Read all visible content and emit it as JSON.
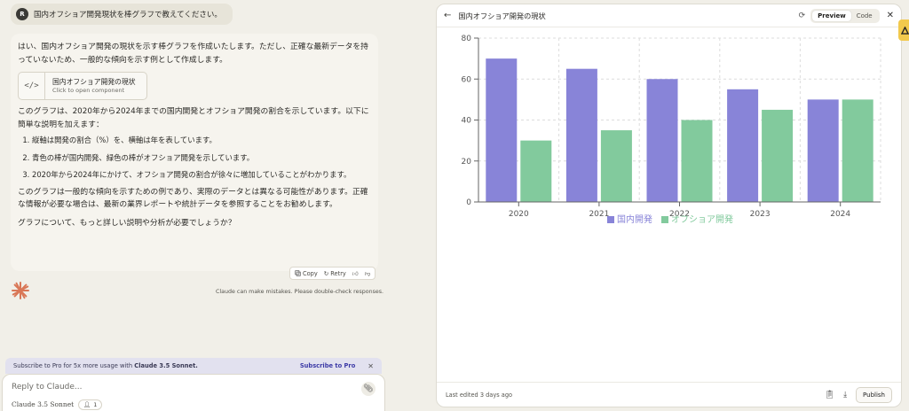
{
  "user_message": {
    "avatar": "R",
    "text": "国内オフショア開発現状を棒グラフで教えてください。"
  },
  "assistant": {
    "intro": "はい、国内オフショア開発の現状を示す棒グラフを作成いたします。ただし、正確な最新データを持っていないため、一般的な傾向を示す例として作成します。",
    "artifact": {
      "icon": "</>",
      "title": "国内オフショア開発の現状",
      "subtitle": "Click to open component"
    },
    "para2": "このグラフは、2020年から2024年までの国内開発とオフショア開発の割合を示しています。以下に簡単な説明を加えます：",
    "list": [
      "縦軸は開発の割合（%）を、横軸は年を表しています。",
      "青色の棒が国内開発、緑色の棒がオフショア開発を示しています。",
      "2020年から2024年にかけて、オフショア開発の割合が徐々に増加していることがわかります。"
    ],
    "para3": "このグラフは一般的な傾向を示すための例であり、実際のデータとは異なる可能性があります。正確な情報が必要な場合は、最新の業界レポートや統計データを参照することをお勧めします。",
    "para4": "グラフについて、もっと詳しい説明や分析が必要でしょうか？",
    "actions": {
      "copy": "Copy",
      "retry": "Retry"
    }
  },
  "disclaimer": "Claude can make mistakes. Please double-check responses.",
  "subscribe": {
    "text_pre": "Subscribe to Pro for 5x more usage with ",
    "text_bold": "Claude 3.5 Sonnet.",
    "link": "Subscribe to Pro",
    "close": "✕"
  },
  "composer": {
    "placeholder": "Reply to Claude...",
    "model": "Claude 3.5 Sonnet",
    "count": "1"
  },
  "panel": {
    "title": "国内オフショア開発の現状",
    "tabs": {
      "preview": "Preview",
      "code": "Code"
    },
    "footer": {
      "edited": "Last edited 3 days ago",
      "publish": "Publish"
    }
  },
  "chart_data": {
    "type": "bar",
    "categories": [
      "2020",
      "2021",
      "2022",
      "2023",
      "2024"
    ],
    "series": [
      {
        "name": "国内開発",
        "values": [
          70,
          65,
          60,
          55,
          50
        ],
        "color": "#8884d8"
      },
      {
        "name": "オフショア開発",
        "values": [
          30,
          35,
          40,
          45,
          50
        ],
        "color": "#82ca9d"
      }
    ],
    "yticks": [
      0,
      20,
      40,
      60,
      80
    ],
    "ylim": [
      0,
      80
    ],
    "grid": true,
    "legend": "bottom-center"
  }
}
